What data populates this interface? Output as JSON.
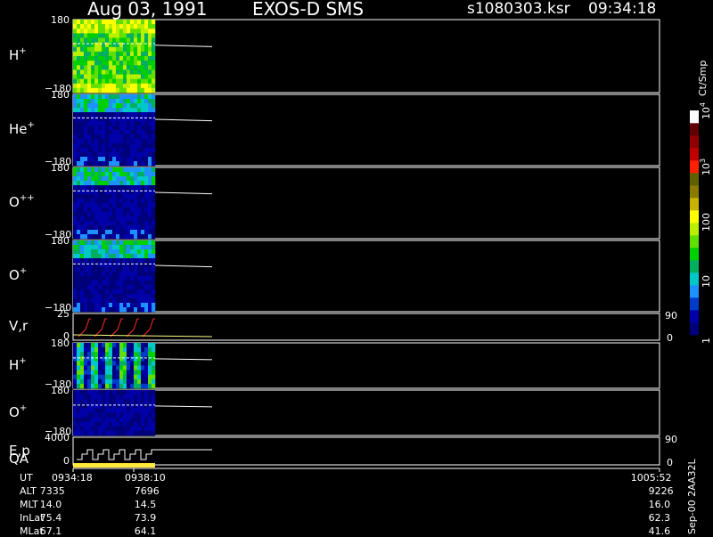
{
  "header": {
    "date": "Aug 03, 1991",
    "instrument": "EXOS-D SMS",
    "file": "s1080303.ksr",
    "time": "09:34:18"
  },
  "colors": {
    "background": "#000000",
    "axis": "#ffffff",
    "qa_bar": "#ffe83a",
    "velocity_trace": "#ff3020"
  },
  "panels": [
    {
      "id": "h-plus",
      "label": "H",
      "sup": "+",
      "ytop": "180",
      "ybot": "−180",
      "type": "spectrogram"
    },
    {
      "id": "he-plus",
      "label": "He",
      "sup": "+",
      "ytop": "180",
      "ybot": "−180",
      "type": "spectrogram"
    },
    {
      "id": "o-pp",
      "label": "O",
      "sup": "++",
      "ytop": "180",
      "ybot": "−180",
      "type": "spectrogram"
    },
    {
      "id": "o-plus",
      "label": "O",
      "sup": "+",
      "ytop": "180",
      "ybot": "−180",
      "type": "spectrogram"
    },
    {
      "id": "vr",
      "label": "V,r",
      "sup": "",
      "ytop": "25",
      "ybot": "0",
      "right_top": "90",
      "right_bot": "0",
      "type": "line"
    },
    {
      "id": "h-plus-2",
      "label": "H",
      "sup": "+",
      "ytop": "180",
      "ybot": "−180",
      "type": "spectrogram"
    },
    {
      "id": "o-plus-2",
      "label": "O",
      "sup": "+",
      "ytop": "180",
      "ybot": "−180",
      "type": "spectrogram"
    },
    {
      "id": "ep",
      "label": "E,p",
      "sup": "",
      "ytop": "4000",
      "ybot": "0",
      "right_top": "90",
      "right_bot": "0",
      "type": "line"
    }
  ],
  "qa_label": "QA",
  "colorbar": {
    "unit": "Ct/Smp",
    "ticks": [
      {
        "text": "10",
        "sup": "4",
        "level": 1.0
      },
      {
        "text": "10",
        "sup": "3",
        "level": 0.75
      },
      {
        "text": "100",
        "sup": "",
        "level": 0.5
      },
      {
        "text": "10",
        "sup": "",
        "level": 0.25
      },
      {
        "text": "1",
        "sup": "",
        "level": 0.0
      }
    ],
    "colors": [
      "#00007a",
      "#0000a8",
      "#003cc8",
      "#1e90ff",
      "#00c8c8",
      "#00b060",
      "#00d000",
      "#60e000",
      "#b8f000",
      "#ffff00",
      "#c8b400",
      "#8a7a00",
      "#606000",
      "#ff2000",
      "#c00000",
      "#900000",
      "#600000",
      "#ffffff"
    ]
  },
  "footer": {
    "rows": [
      {
        "name": "UT",
        "values": [
          "0934:18",
          "0938:10",
          "1005:52"
        ]
      },
      {
        "name": "ALT",
        "values": [
          "7335",
          "7696",
          "9226"
        ]
      },
      {
        "name": "MLT",
        "values": [
          "14.0",
          "14.5",
          "16.0"
        ]
      },
      {
        "name": "InLat",
        "values": [
          "75.4",
          "73.9",
          "62.3"
        ]
      },
      {
        "name": "MLat",
        "values": [
          "67.1",
          "64.1",
          "41.6"
        ]
      }
    ],
    "side_label": "Sep-00 2AA32L"
  },
  "chart_data": {
    "type": "heatmap",
    "title": "Aug 03, 1991 EXOS-D SMS",
    "x_ticks": [
      "0934:18",
      "0938:10",
      "1005:52"
    ],
    "panels": [
      "H+",
      "He+",
      "O++",
      "O+",
      "V,r",
      "H+",
      "O+",
      "E,p"
    ],
    "ylim_pitch": [
      -180,
      180
    ],
    "ylim_vr": [
      0,
      25
    ],
    "ylim_ep": [
      0,
      4000
    ],
    "colorbar_unit": "Ct/Smp",
    "colorbar_range": [
      1,
      10000
    ],
    "colorbar_scale": "log"
  }
}
